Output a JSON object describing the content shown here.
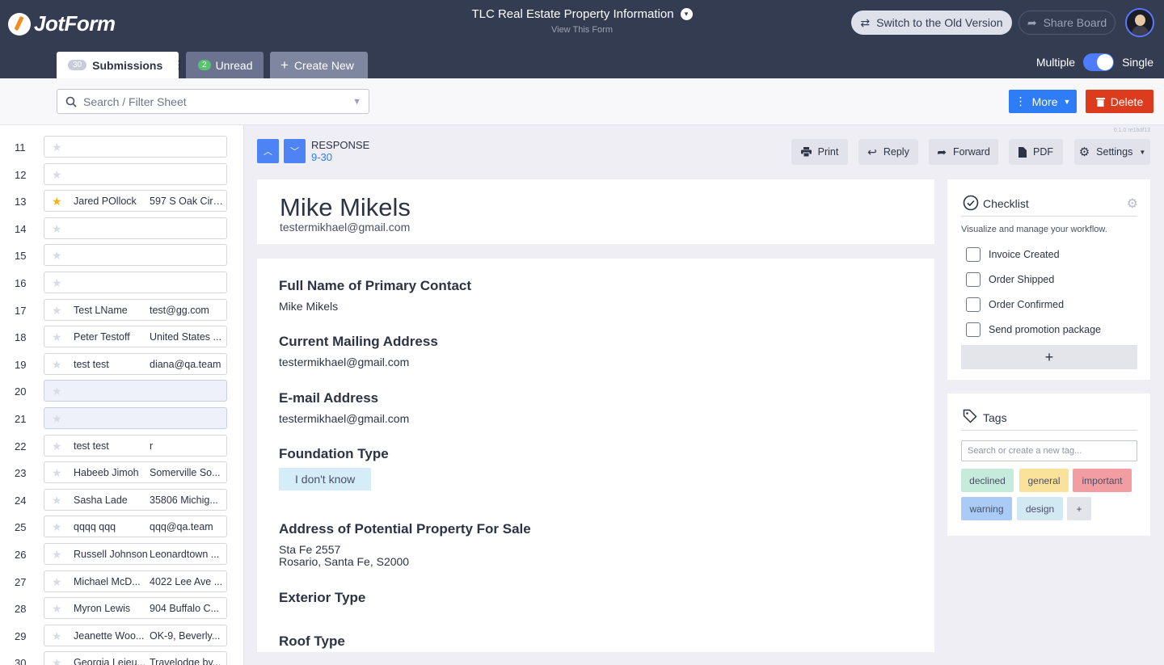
{
  "app": {
    "logo_text": "JotForm"
  },
  "header": {
    "form_title": "TLC Real Estate Property Information",
    "subtitle": "View This Form",
    "switch_label": "Switch to the Old Version",
    "share_label": "Share Board"
  },
  "tabs": {
    "submissions": {
      "count": "30",
      "label": "Submissions"
    },
    "unread": {
      "count": "2",
      "label": "Unread"
    },
    "create": {
      "label": "Create New"
    },
    "toggle_left": "Multiple",
    "toggle_right": "Single"
  },
  "toolbar": {
    "search_placeholder": "Search / Filter Sheet",
    "more_label": "More",
    "delete_label": "Delete",
    "version": "0.1.0 re1bdf13"
  },
  "list": [
    {
      "num": "11",
      "starred": false,
      "c1": "",
      "c2": ""
    },
    {
      "num": "12",
      "starred": false,
      "c1": "",
      "c2": ""
    },
    {
      "num": "13",
      "starred": true,
      "c1": "Jared POllock",
      "c2": "597 S Oak Cir ..."
    },
    {
      "num": "14",
      "starred": false,
      "c1": "",
      "c2": ""
    },
    {
      "num": "15",
      "starred": false,
      "c1": "",
      "c2": ""
    },
    {
      "num": "16",
      "starred": false,
      "c1": "",
      "c2": ""
    },
    {
      "num": "17",
      "starred": false,
      "c1": "Test LName",
      "c2": "test@gg.com"
    },
    {
      "num": "18",
      "starred": false,
      "c1": "Peter Testoff",
      "c2": "United States ..."
    },
    {
      "num": "19",
      "starred": false,
      "c1": "test test",
      "c2": "diana@qa.team"
    },
    {
      "num": "20",
      "starred": false,
      "c1": "",
      "c2": "",
      "selected": true
    },
    {
      "num": "21",
      "starred": false,
      "c1": "",
      "c2": "",
      "selected": true
    },
    {
      "num": "22",
      "starred": false,
      "c1": "test test",
      "c2": "r"
    },
    {
      "num": "23",
      "starred": false,
      "c1": "Habeeb Jimoh",
      "c2": "Somerville So..."
    },
    {
      "num": "24",
      "starred": false,
      "c1": "Sasha Lade",
      "c2": "35806 Michig..."
    },
    {
      "num": "25",
      "starred": false,
      "c1": "qqqq qqq",
      "c2": "qqq@qa.team"
    },
    {
      "num": "26",
      "starred": false,
      "c1": "Russell Johnson",
      "c2": "Leonardtown ..."
    },
    {
      "num": "27",
      "starred": false,
      "c1": "Michael McD...",
      "c2": "4022 Lee Ave ..."
    },
    {
      "num": "28",
      "starred": false,
      "c1": "Myron Lewis",
      "c2": "904 Buffalo C..."
    },
    {
      "num": "29",
      "starred": false,
      "c1": "Jeanette Woo...",
      "c2": "OK-9, Beverly..."
    },
    {
      "num": "30",
      "starred": false,
      "c1": "Georgia Lejeu...",
      "c2": "Travelodge by..."
    }
  ],
  "response": {
    "label": "RESPONSE",
    "range": "9-30",
    "actions": {
      "print": "Print",
      "reply": "Reply",
      "forward": "Forward",
      "pdf": "PDF",
      "settings": "Settings"
    },
    "name": "Mike Mikels",
    "email": "testermikhael@gmail.com",
    "fields": [
      {
        "q": "Full Name of Primary Contact",
        "a": "Mike Mikels"
      },
      {
        "q": "Current Mailing Address",
        "a": "testermikhael@gmail.com"
      },
      {
        "q": "E-mail Address",
        "a": "testermikhael@gmail.com"
      },
      {
        "q": "Foundation Type",
        "chip": "I don't know"
      },
      {
        "q": "Address of Potential Property For Sale",
        "a": "Sta Fe 2557",
        "a2": "Rosario, Santa Fe, S2000"
      },
      {
        "q": "Exterior Type"
      },
      {
        "q": "Roof Type"
      }
    ]
  },
  "checklist": {
    "title": "Checklist",
    "description": "Visualize and manage your workflow.",
    "items": [
      "Invoice Created",
      "Order Shipped",
      "Order Confirmed",
      "Send promotion package"
    ],
    "add": "+"
  },
  "tags": {
    "title": "Tags",
    "placeholder": "Search or create a new tag...",
    "items": [
      {
        "label": "declined",
        "color": "#c5ebdd"
      },
      {
        "label": "general",
        "color": "#fbe29a"
      },
      {
        "label": "important",
        "color": "#f29da2"
      },
      {
        "label": "warning",
        "color": "#a9cbf5"
      },
      {
        "label": "design",
        "color": "#d2e8f3"
      },
      {
        "label": "+",
        "color": "#e4e5eb"
      }
    ]
  },
  "colors": {
    "accent": "#2e7cf6",
    "danger": "#dc3b1e",
    "header": "#343c52"
  }
}
